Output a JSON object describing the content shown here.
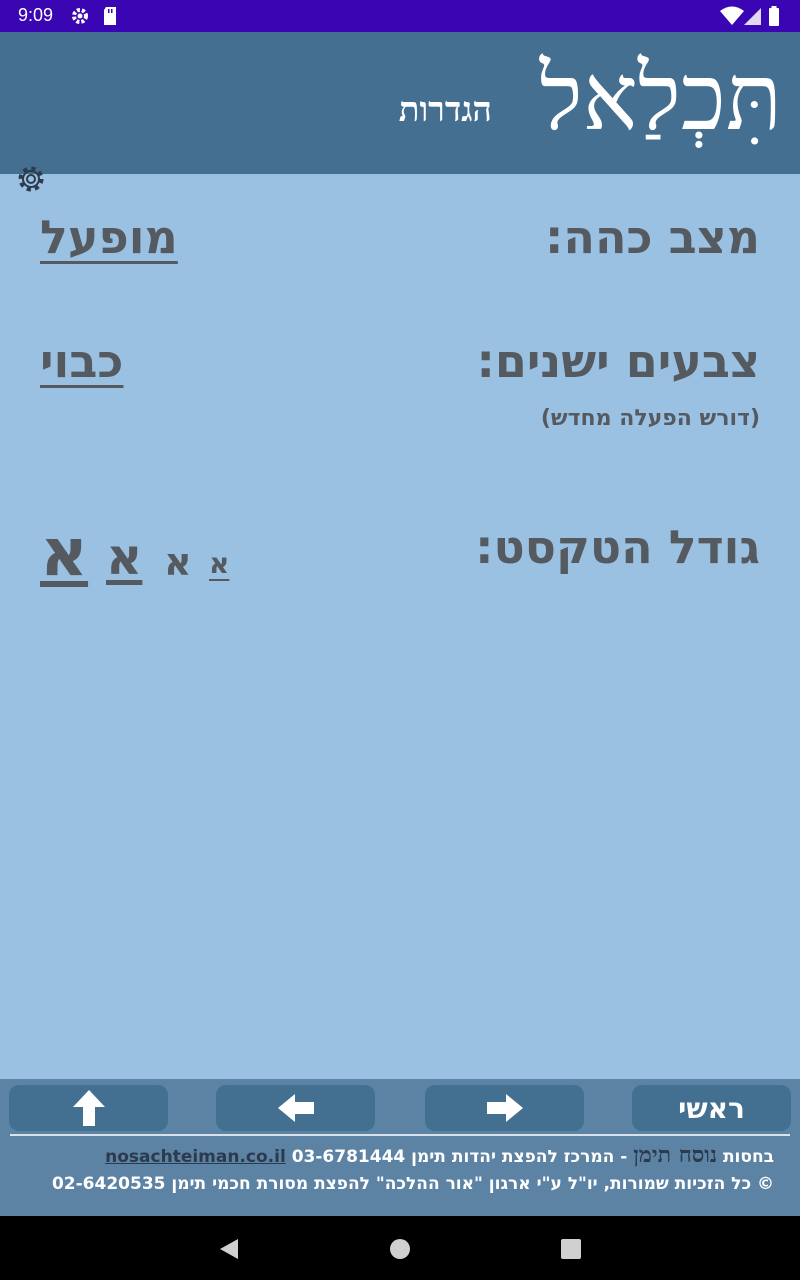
{
  "status_bar": {
    "time": "9:09",
    "colors": {
      "background": "#3a06b4"
    },
    "icons": [
      "gear-icon",
      "sd-card-icon",
      "wifi-icon",
      "cell-signal-icon",
      "battery-icon"
    ]
  },
  "header": {
    "app_title": "תִּכְלַאל",
    "screen_title": "הגדרות",
    "settings_icon": "gear-icon",
    "colors": {
      "background": "#446f90"
    }
  },
  "settings": {
    "dark_mode": {
      "label": "מצב כהה:",
      "value": "מופעל"
    },
    "old_colors": {
      "label": "צבעים ישנים:",
      "value": "כבוי",
      "note": "(דורש הפעלה מחדש)"
    },
    "text_size": {
      "label": "גודל הטקסט:",
      "options": [
        "א",
        "א",
        "א",
        "א"
      ]
    }
  },
  "navigation": {
    "home_label": "ראשי",
    "buttons": [
      "arrow-up-icon",
      "arrow-left-icon",
      "arrow-right-icon"
    ]
  },
  "footer": {
    "line1_prefix": "בחסות",
    "brand": "נוסח תימן",
    "line1_desc": "- המרכז להפצת יהדות תימן 03-6781444",
    "link": "nosachteiman.co.il",
    "line2": "© כל הזכיות שמורות, יו\"ל ע\"י ארגון \"אור ההלכה\" להפצת מסורת חכמי תימן 02-6420535"
  },
  "colors": {
    "page_background": "#9bc1e2",
    "text": "#555a61",
    "button": "#436f91",
    "panel": "#5d83a4"
  }
}
